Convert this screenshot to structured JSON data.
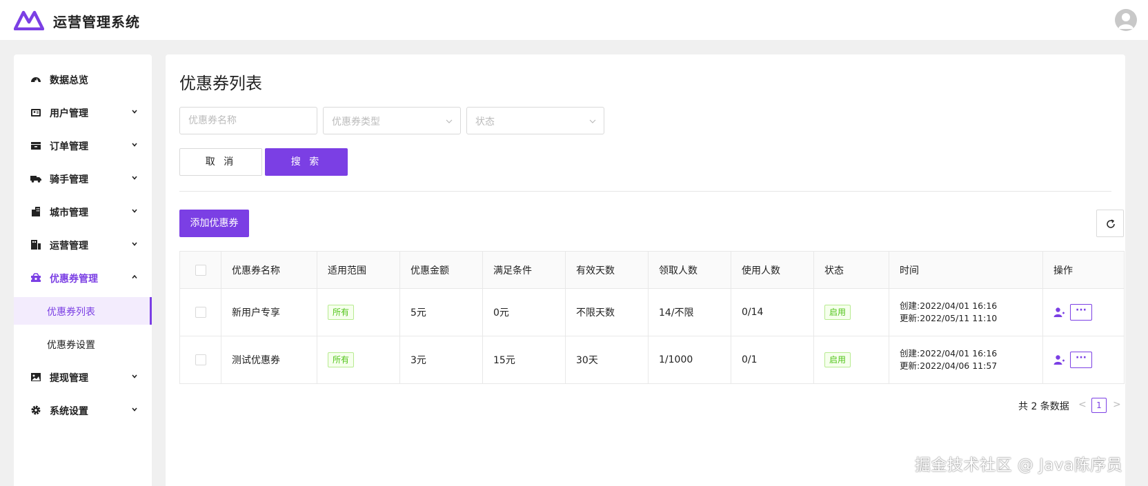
{
  "app": {
    "title": "运营管理系统"
  },
  "sidebar": {
    "items": [
      {
        "label": "数据总览",
        "icon": "dashboard-icon",
        "expandable": false
      },
      {
        "label": "用户管理",
        "icon": "user-card-icon",
        "expandable": true
      },
      {
        "label": "订单管理",
        "icon": "order-box-icon",
        "expandable": true
      },
      {
        "label": "骑手管理",
        "icon": "truck-icon",
        "expandable": true
      },
      {
        "label": "城市管理",
        "icon": "building-icon",
        "expandable": true
      },
      {
        "label": "运营管理",
        "icon": "chart-icon",
        "expandable": true
      },
      {
        "label": "优惠券管理",
        "icon": "coupon-icon",
        "expandable": true,
        "expanded": true
      },
      {
        "label": "提现管理",
        "icon": "image-icon",
        "expandable": true
      },
      {
        "label": "系统设置",
        "icon": "gear-icon",
        "expandable": true
      }
    ],
    "sub_items": [
      {
        "label": "优惠券列表",
        "selected": true
      },
      {
        "label": "优惠券设置",
        "selected": false
      }
    ]
  },
  "main": {
    "title": "优惠券列表",
    "filters": {
      "name_placeholder": "优惠券名称",
      "type_placeholder": "优惠券类型",
      "status_placeholder": "状态"
    },
    "buttons": {
      "cancel": "取 消",
      "search": "搜 索",
      "add": "添加优惠券"
    },
    "table": {
      "headers": [
        "优惠券名称",
        "适用范围",
        "优惠金额",
        "满足条件",
        "有效天数",
        "领取人数",
        "使用人数",
        "状态",
        "时间",
        "操作"
      ],
      "rows": [
        {
          "name": "新用户专享",
          "scope": "所有",
          "amount": "5元",
          "condition": "0元",
          "days": "不限天数",
          "received": "14/不限",
          "used": "0/14",
          "status": "启用",
          "created": "创建:2022/04/01 16:16",
          "updated": "更新:2022/05/11 11:10"
        },
        {
          "name": "测试优惠券",
          "scope": "所有",
          "amount": "3元",
          "condition": "15元",
          "days": "30天",
          "received": "1/1000",
          "used": "0/1",
          "status": "启用",
          "created": "创建:2022/04/01 16:16",
          "updated": "更新:2022/04/06 11:57"
        }
      ]
    },
    "pagination": {
      "total_text": "共 2 条数据",
      "current_page": "1",
      "prev": "<",
      "next": ">"
    }
  },
  "watermark": "掘金技术社区 @ Java陈序员",
  "colors": {
    "accent": "#7b3fe4",
    "status_green": "#52c41a",
    "background": "#f0f0f0"
  }
}
